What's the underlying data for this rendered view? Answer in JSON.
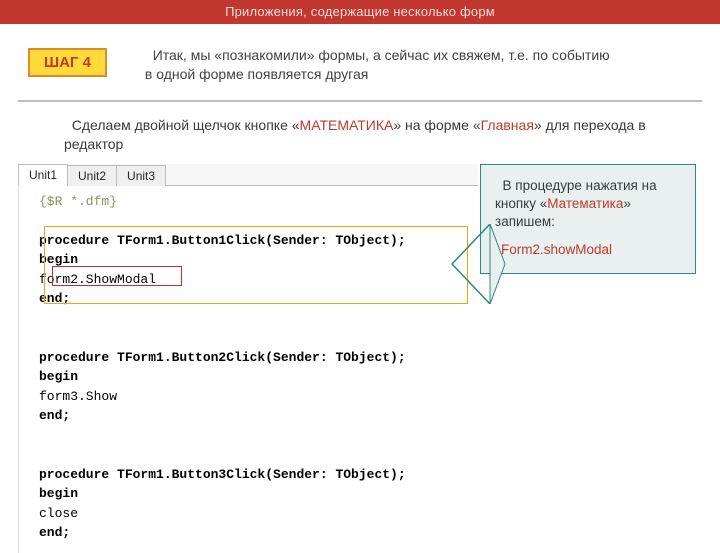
{
  "header": {
    "title": "Приложения, содержащие несколько форм"
  },
  "step": {
    "badge": "ШАГ 4",
    "text_before": "Итак, мы «познакомили» формы, а сейчас их свяжем, т.е. по событию в одной форме появляется другая"
  },
  "instruction": {
    "p1a": "Сделаем двойной щелчок кнопке «",
    "p1_hl1": "МАТЕМАТИКА",
    "p1b": "» на форме «",
    "p1_hl2": "Главная",
    "p1c": "» для перехода в редактор"
  },
  "tabs": [
    "Unit1",
    "Unit2",
    "Unit3"
  ],
  "code": {
    "directive": "{$R *.dfm}",
    "p1_sig": "procedure TForm1.Button1Click(Sender: TObject);",
    "begin": "begin",
    "p1_body": "form2.ShowModal",
    "end": "end;",
    "p2_sig": "procedure TForm1.Button2Click(Sender: TObject);",
    "p2_body": "form3.Show",
    "p3_sig": "procedure TForm1.Button3Click(Sender: TObject);",
    "p3_body": "close"
  },
  "hint": {
    "line1a": "В процедуре нажатия на кнопку «",
    "line1_hl": "Математика",
    "line1b": "» запишем:",
    "code": "Form2.showModal"
  }
}
